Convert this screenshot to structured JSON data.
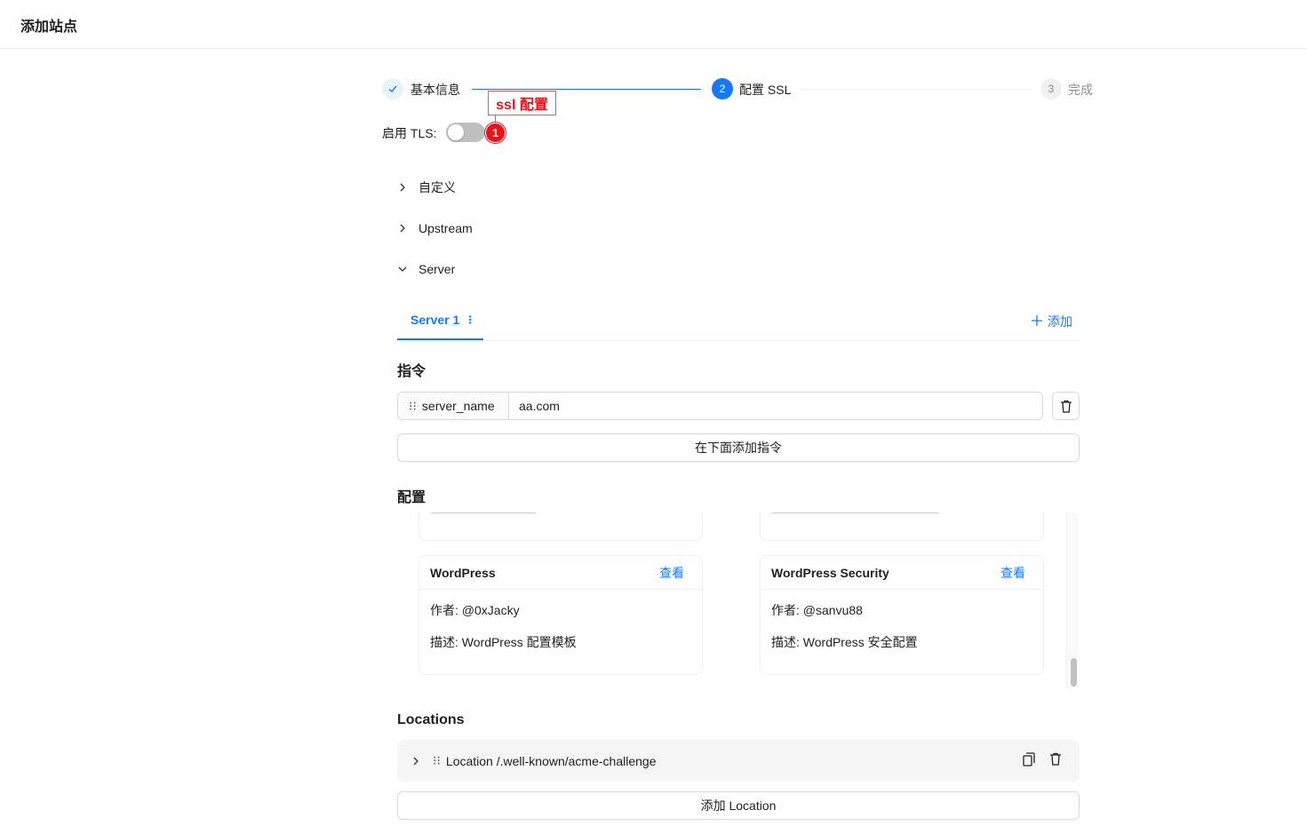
{
  "header": {
    "title": "添加站点"
  },
  "steps": [
    {
      "label": "基本信息",
      "status": "done"
    },
    {
      "number": "2",
      "label": "配置 SSL",
      "status": "active"
    },
    {
      "number": "3",
      "label": "完成",
      "status": "wait"
    }
  ],
  "tls": {
    "label": "启用 TLS:",
    "enabled": false
  },
  "annotation": {
    "text": "ssl 配置",
    "number": "1",
    "color": "#e8141a"
  },
  "collapses": [
    {
      "label": "自定义",
      "expanded": false
    },
    {
      "label": "Upstream",
      "expanded": false
    },
    {
      "label": "Server",
      "expanded": true
    }
  ],
  "server_tabs": {
    "active": "Server 1",
    "add_label": "添加"
  },
  "directives": {
    "title": "指令",
    "items": [
      {
        "name": "server_name",
        "value": "aa.com"
      }
    ],
    "add_button": "在下面添加指令"
  },
  "config": {
    "title": "配置",
    "cards": [
      {
        "title": "WordPress",
        "link": "查看",
        "author": "作者: @0xJacky",
        "description": "描述: WordPress 配置模板"
      },
      {
        "title": "WordPress Security",
        "link": "查看",
        "author": "作者: @sanvu88",
        "description": "描述: WordPress 安全配置"
      }
    ]
  },
  "locations": {
    "title": "Locations",
    "items": [
      {
        "label": "Location /.well-known/acme-challenge"
      }
    ],
    "add_button": "添加 Location"
  },
  "colors": {
    "primary": "#1677ff",
    "annotation": "#e8141a"
  }
}
